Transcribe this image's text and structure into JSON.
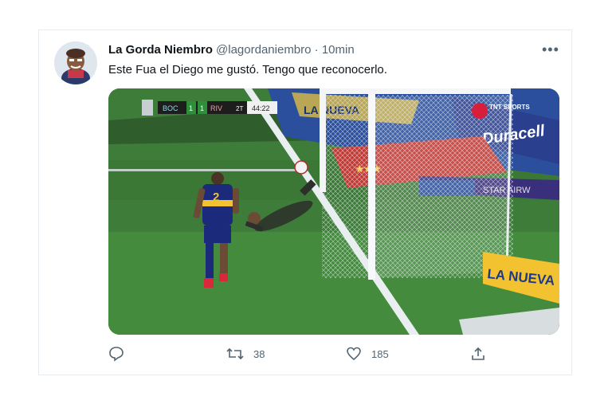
{
  "tweet": {
    "display_name": "La Gorda Niembro",
    "handle": "@lagordaniembro",
    "separator": "·",
    "time": "10min",
    "more_label": "•••",
    "text": "Este Fua el Diego me gustó. Tengo que reconocerlo."
  },
  "media": {
    "scoreboard": {
      "home": "BOC",
      "home_score": "1",
      "away_score": "1",
      "away": "RIV",
      "period": "2T",
      "clock": "44:22"
    },
    "player_number": "2",
    "ads": {
      "left_banner": "LA NUEVA",
      "bottom_banner": "LA NUEVA",
      "right_banner": "Duracell",
      "airline": "STAR AIRW",
      "tnt_logo": "TNT SPORTS"
    }
  },
  "actions": {
    "reply_icon": "reply-icon",
    "retweet_icon": "retweet-icon",
    "retweet_count": "38",
    "like_icon": "like-icon",
    "like_count": "185",
    "share_icon": "share-icon"
  },
  "colors": {
    "text_primary": "#0f1419",
    "text_secondary": "#536471",
    "border": "#e6ecf0",
    "pitch": "#3d7a3a"
  }
}
